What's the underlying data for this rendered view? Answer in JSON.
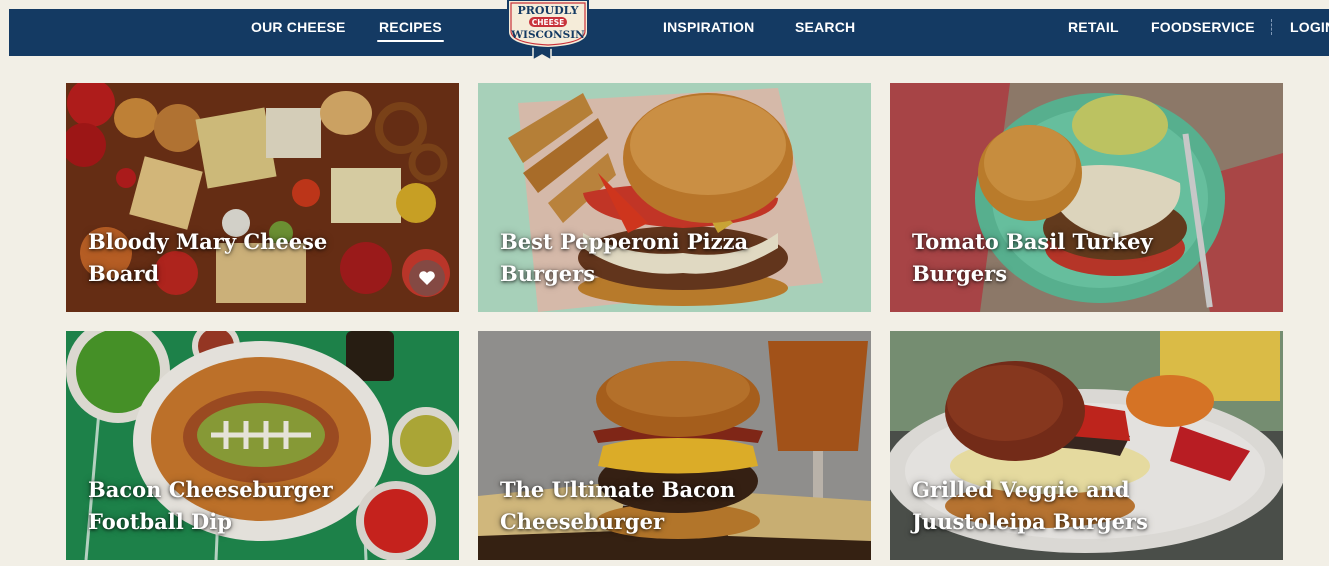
{
  "nav": {
    "our_cheese": "OUR CHEESE",
    "recipes": "RECIPES",
    "inspiration": "INSPIRATION",
    "search": "SEARCH",
    "retail": "RETAIL",
    "foodservice": "FOODSERVICE",
    "login": "LOGIN"
  },
  "logo": {
    "line1": "PROUDLY",
    "line2": "CHEESE",
    "line3": "WISCONSIN"
  },
  "recipes": [
    {
      "title": "Bloody Mary Cheese Board",
      "favorite": true
    },
    {
      "title": "Best Pepperoni Pizza Burgers"
    },
    {
      "title": "Tomato Basil Turkey Burgers"
    },
    {
      "title": "Bacon Cheeseburger Football Dip"
    },
    {
      "title": "The Ultimate Bacon Cheeseburger"
    },
    {
      "title": "Grilled Veggie and Juustoleipa Burgers"
    }
  ],
  "colors": {
    "nav_bg": "#143a63",
    "page_bg": "#f2efe6",
    "logo_red": "#c8323a"
  }
}
